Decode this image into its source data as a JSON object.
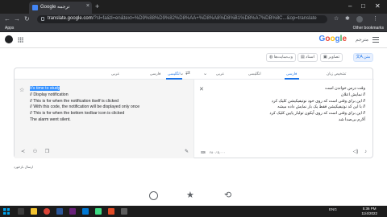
{
  "browser": {
    "tab_title": "Google ترجمه",
    "tab_close": "×",
    "new_tab": "+",
    "url_host": "translate.google.com",
    "url_rest": "/?sl=fa&tl=en&text=%D9%88%D9%82%D8%AA+%D8%A8%D8%B1%D8%A7%DB%8C...&op=translate",
    "bookmarks_apps": "Apps",
    "bookmarks_other": "Other bookmarks",
    "win_min": "–",
    "win_max": "□",
    "win_close": "✕"
  },
  "header": {
    "logo": [
      "G",
      "o",
      "o",
      "g",
      "l",
      "e"
    ],
    "logo_suffix": "مترجم",
    "menu_icon": "hamburger"
  },
  "modes": [
    {
      "label": "متن",
      "active": true
    },
    {
      "label": "تصاویر",
      "active": false
    },
    {
      "label": "اسناد",
      "active": false
    },
    {
      "label": "وب‌سایت‌ها",
      "active": false
    }
  ],
  "target_langs": [
    "انگلیسی",
    "فارسی",
    "عربی"
  ],
  "source_langs": [
    "تشخیص زبان",
    "فارسی",
    "انگلیسی",
    "عربی"
  ],
  "output": {
    "highlighted": "It's time to study",
    "lines": [
      "// Display notification",
      "// This is for when the notification itself is clicked",
      "// With this code, the notification will be displayed only once",
      "// This is for when the bottom toolbar icon is clicked",
      "The alarm went silent."
    ]
  },
  "input": {
    "lines": [
      "وقت درس خواندن است",
      "// نمایش اعلان",
      "// این برای وقتی است که روی خود نوتیفیکیشن کلیک کرد",
      "// با این کد نوتیفیکیشن فقط یک بار نمایش داده میشه",
      "// این برای وقتی است که روی آیکون تولبار پایین کلیک کرد",
      "آلارم بی‌صدا شد"
    ],
    "char_count": "۲۸۰ / ۵,۰۰۰"
  },
  "send_feedback": "ارسال بازخورد",
  "taskbar": {
    "lang": "ENG",
    "time": "5:36 PM",
    "date": "11/4/2022"
  },
  "colors": {
    "accent": "#1a73e8",
    "highlight": "#3390ff"
  }
}
